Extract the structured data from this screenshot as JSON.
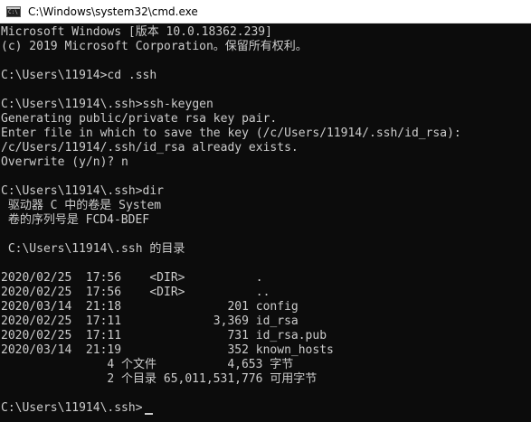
{
  "window": {
    "title": "C:\\Windows\\system32\\cmd.exe",
    "icon": "cmd-app-icon"
  },
  "console": {
    "lines": [
      "Microsoft Windows [版本 10.0.18362.239]",
      "(c) 2019 Microsoft Corporation。保留所有权利。",
      "",
      "C:\\Users\\11914>cd .ssh",
      "",
      "C:\\Users\\11914\\.ssh>ssh-keygen",
      "Generating public/private rsa key pair.",
      "Enter file in which to save the key (/c/Users/11914/.ssh/id_rsa):",
      "/c/Users/11914/.ssh/id_rsa already exists.",
      "Overwrite (y/n)? n",
      "",
      "C:\\Users\\11914\\.ssh>dir",
      " 驱动器 C 中的卷是 System",
      " 卷的序列号是 FCD4-BDEF",
      "",
      " C:\\Users\\11914\\.ssh 的目录",
      "",
      "2020/02/25  17:56    <DIR>          .",
      "2020/02/25  17:56    <DIR>          ..",
      "2020/03/14  21:18               201 config",
      "2020/02/25  17:11             3,369 id_rsa",
      "2020/02/25  17:11               731 id_rsa.pub",
      "2020/03/14  21:19               352 known_hosts",
      "               4 个文件          4,653 字节",
      "               2 个目录 65,011,531,776 可用字节",
      "",
      "C:\\Users\\11914\\.ssh>"
    ]
  },
  "colors": {
    "background": "#0c0c0c",
    "text": "#cccccc",
    "titlebar": "#ffffff"
  }
}
